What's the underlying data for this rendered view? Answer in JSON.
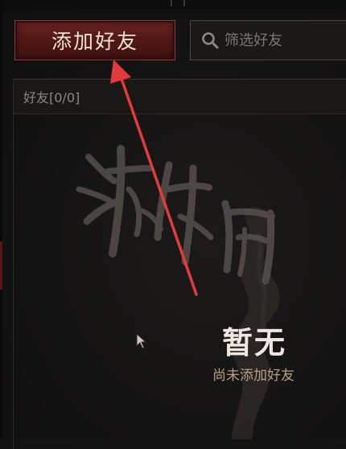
{
  "toolbar": {
    "add_friend_label": "添加好友",
    "search_placeholder": "筛选好友"
  },
  "friends": {
    "header_label": "好友[0/0]"
  },
  "empty_state": {
    "title": "暂无",
    "subtitle": "尚未添加好友"
  },
  "watermark": {
    "text": "游侠网"
  },
  "colors": {
    "accent": "#6a2320",
    "arrow": "#e33b3b",
    "empty_subtitle": "#b79e86"
  },
  "icons": {
    "search": "search-icon",
    "cursor": "mouse-pointer-icon"
  }
}
